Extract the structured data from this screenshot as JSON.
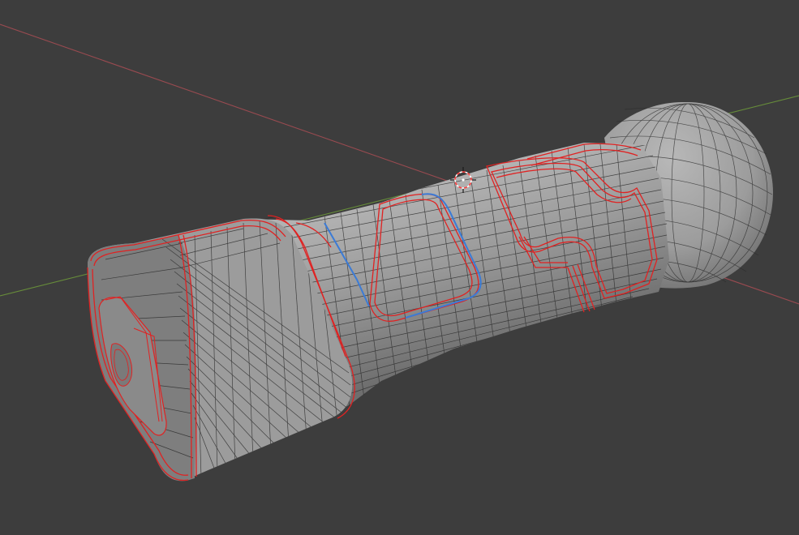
{
  "viewport": {
    "background": "#3d3d3d",
    "mode": "edit-mode-wireframe-overlay"
  },
  "axes": {
    "x_axis_color": "#b04e55",
    "y_axis_color": "#6e9a3a"
  },
  "mesh": {
    "object": "lightsaber-hilt",
    "surface_color": "#8e8e8e",
    "wire_color": "#2a2a2a",
    "seam_color": "#e02222",
    "active_edge_color": "#3b7bd6"
  },
  "cursor": {
    "icon": "3d-cursor-icon",
    "colors": [
      "#ffffff",
      "#ff4040"
    ]
  }
}
